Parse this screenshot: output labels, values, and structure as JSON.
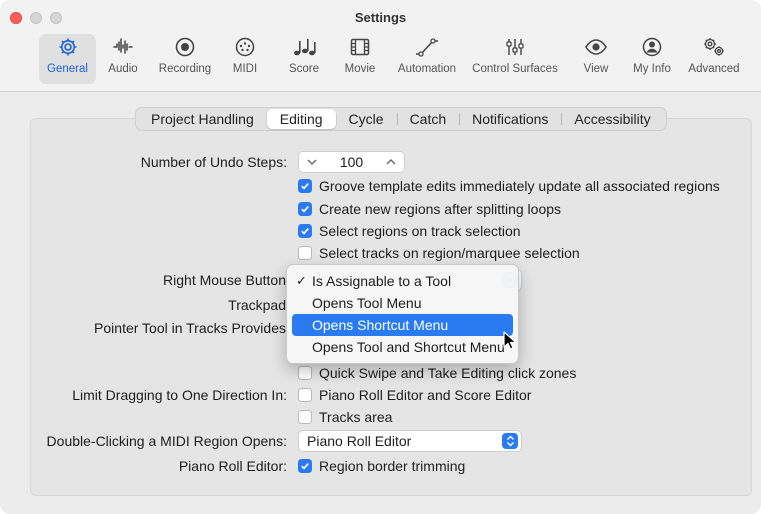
{
  "window": {
    "title": "Settings"
  },
  "toolbar": [
    {
      "label": "General",
      "icon": "gear-icon",
      "active": true
    },
    {
      "label": "Audio",
      "icon": "waveform-icon"
    },
    {
      "label": "Recording",
      "icon": "record-icon"
    },
    {
      "label": "MIDI",
      "icon": "midi-port-icon"
    },
    {
      "label": "Score",
      "icon": "music-notes-icon"
    },
    {
      "label": "Movie",
      "icon": "film-icon"
    },
    {
      "label": "Automation",
      "icon": "automation-curve-icon"
    },
    {
      "label": "Control Surfaces",
      "icon": "faders-icon"
    },
    {
      "label": "View",
      "icon": "eye-icon"
    },
    {
      "label": "My Info",
      "icon": "person-icon"
    },
    {
      "label": "Advanced",
      "icon": "gears-icon"
    }
  ],
  "tabs": [
    {
      "label": "Project Handling"
    },
    {
      "label": "Editing",
      "active": true
    },
    {
      "label": "Cycle"
    },
    {
      "label": "Catch"
    },
    {
      "label": "Notifications"
    },
    {
      "label": "Accessibility"
    }
  ],
  "labels": {
    "undo_steps": "Number of Undo Steps:",
    "right_mouse": "Right Mouse Button",
    "trackpad": "Trackpad",
    "pointer_tool": "Pointer Tool in Tracks Provides",
    "limit_dragging": "Limit Dragging to One Direction In:",
    "double_click": "Double-Clicking a MIDI Region Opens:",
    "piano_roll_editor": "Piano Roll Editor:"
  },
  "undo_stepper": {
    "value": "100"
  },
  "checkboxes": [
    {
      "label": "Groove template edits immediately update all associated regions",
      "checked": true
    },
    {
      "label": "Create new regions after splitting loops",
      "checked": true
    },
    {
      "label": "Select regions on track selection",
      "checked": true
    },
    {
      "label": "Select tracks on region/marquee selection",
      "checked": false
    },
    {
      "label": "Quick Swipe and Take Editing click zones",
      "checked": false
    },
    {
      "label": "Piano Roll Editor and Score Editor",
      "checked": false
    },
    {
      "label": "Tracks area",
      "checked": false
    },
    {
      "label": "Region border trimming",
      "checked": true
    }
  ],
  "dropdown_menu": {
    "items": [
      {
        "label": "Is Assignable to a Tool",
        "checked": true
      },
      {
        "label": "Opens Tool Menu"
      },
      {
        "label": "Opens Shortcut Menu",
        "highlighted": true
      },
      {
        "label": "Opens Tool and Shortcut Menu"
      }
    ]
  },
  "double_click_popup": {
    "value": "Piano Roll Editor"
  },
  "colors": {
    "accent": "#2a7bf2",
    "close": "#ff5f57",
    "active_label": "#1a62d6"
  }
}
